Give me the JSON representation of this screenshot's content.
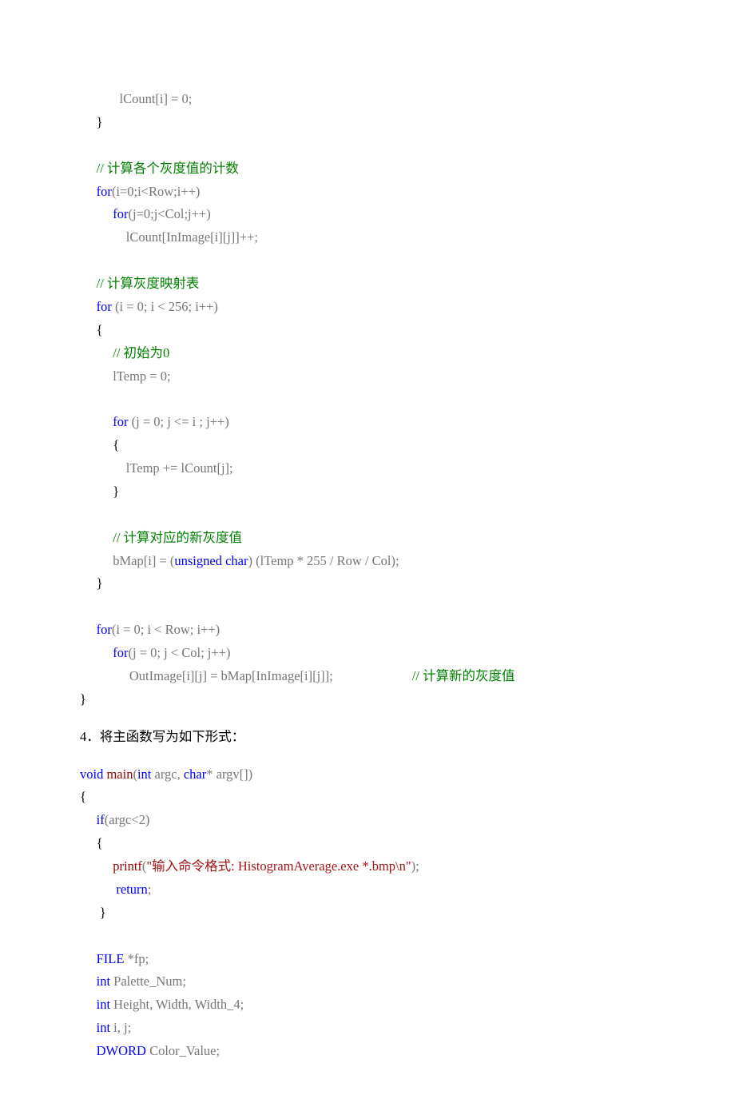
{
  "code": {
    "l1a": "lCount[i] = 0;",
    "l2": "}",
    "l3": "// 计算各个灰度值的计数",
    "l4a": "for",
    "l4b": "(i=0;i<Row;i++)",
    "l5a": "for",
    "l5b": "(j=0;j<Col;j++)",
    "l6": "lCount[InImage[i][j]]++;",
    "l7": "// 计算灰度映射表",
    "l8a": "for",
    "l8b": " (i = 0; i < 256; i++)",
    "l9": "{",
    "l10": "// 初始为0",
    "l11": "lTemp = 0;",
    "l12a": "for",
    "l12b": " (j = 0; j <= i ; j++)",
    "l13": "{",
    "l14": "lTemp += lCount[j];",
    "l15": "}",
    "l16": "// 计算对应的新灰度值",
    "l17a": "bMap[i] = (",
    "l17b": "unsigned",
    "l17c": " ",
    "l17d": "char",
    "l17e": ") (lTemp * 255 / Row / Col);",
    "l18": "}",
    "l19a": "for",
    "l19b": "(i = 0; i < Row; i++)",
    "l20a": "for",
    "l20b": "(j = 0; j < Col; j++)",
    "l21a": "OutImage[i][j] = bMap[InImage[i][j]];",
    "l21b": "// 计算新的灰度值",
    "l22": "}"
  },
  "section": {
    "num": "4．",
    "text": "将主函数写为如下形式："
  },
  "main": {
    "l1a": "void",
    "l1b": " ",
    "l1c": "main",
    "l1d": "(",
    "l1e": "int",
    "l1f": " argc, ",
    "l1g": "char",
    "l1h": "* argv[])",
    "l2": "{",
    "l3a": "if",
    "l3b": "(argc<2)",
    "l4": "{",
    "l5a": "printf",
    "l5b": "(",
    "l5c": "\"输入命令格式: HistogramAverage.exe *.bmp\\n\"",
    "l5d": ");",
    "l6a": "return",
    "l6b": ";",
    "l7": "}",
    "l8a": "FILE",
    "l8b": " *fp;",
    "l9a": "int",
    "l9b": " Palette_Num;",
    "l10a": "int",
    "l10b": " Height, Width, Width_4;",
    "l11a": "int",
    "l11b": " i, j;",
    "l12a": "DWORD",
    "l12b": " Color_Value;"
  }
}
